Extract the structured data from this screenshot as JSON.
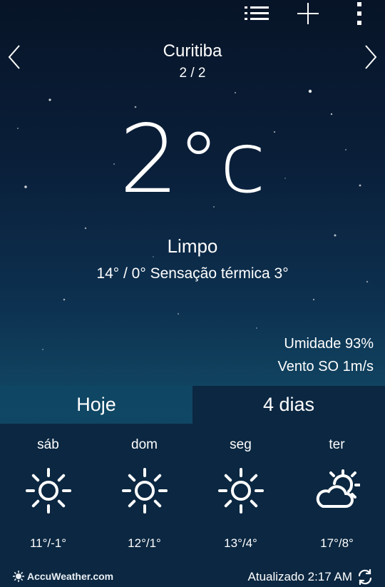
{
  "toolbar": {
    "list_icon": "list-icon",
    "add_icon": "plus-icon",
    "menu_icon": "more-vert-icon"
  },
  "location": {
    "city": "Curitiba",
    "page_indicator": "2 / 2"
  },
  "current": {
    "temperature": "2",
    "unit": "°c",
    "condition": "Limpo",
    "range": "14° / 0°",
    "feels_like": "Sensação térmica 3°",
    "humidity": "Umidade 93%",
    "wind": "Vento SO 1m/s"
  },
  "tabs": [
    {
      "label": "Hoje",
      "selected": false
    },
    {
      "label": "4 dias",
      "selected": true
    }
  ],
  "forecast": [
    {
      "day": "sáb",
      "temps": "11°/-1°",
      "icon": "sun-icon"
    },
    {
      "day": "dom",
      "temps": "12°/1°",
      "icon": "sun-icon"
    },
    {
      "day": "seg",
      "temps": "13°/4°",
      "icon": "sun-icon"
    },
    {
      "day": "ter",
      "temps": "17°/8°",
      "icon": "partly-cloudy-icon"
    }
  ],
  "footer": {
    "brand": "AccuWeather.com",
    "updated": "Atualizado 2:17 AM"
  },
  "colors": {
    "panel": "#0b2741",
    "tab_inactive": "#0f4664",
    "text": "#ffffff"
  }
}
